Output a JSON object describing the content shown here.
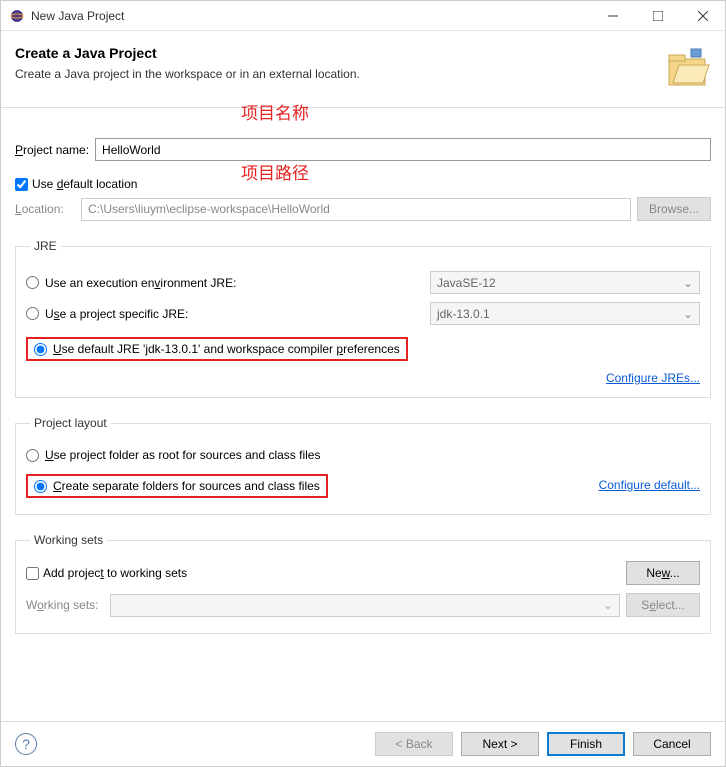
{
  "window": {
    "title": "New Java Project"
  },
  "header": {
    "title": "Create a Java Project",
    "desc": "Create a Java project in the workspace or in an external location."
  },
  "annotations": {
    "name": "项目名称",
    "path": "项目路径"
  },
  "project": {
    "name_label": "Project name:",
    "name_value": "HelloWorld",
    "default_loc_label": "Use default location",
    "location_label": "Location:",
    "location_value": "C:\\Users\\liuym\\eclipse-workspace\\HelloWorld",
    "browse_label": "Browse..."
  },
  "jre": {
    "legend": "JRE",
    "exec_env_label": "Use an execution environment JRE:",
    "exec_env_value": "JavaSE-12",
    "proj_specific_label": "Use a project specific JRE:",
    "proj_specific_value": "jdk-13.0.1",
    "default_label": "Use default JRE 'jdk-13.0.1' and workspace compiler preferences",
    "configure_link": "Configure JREs..."
  },
  "layout": {
    "legend": "Project layout",
    "root_label": "Use project folder as root for sources and class files",
    "separate_label": "Create separate folders for sources and class files",
    "configure_link": "Configure default..."
  },
  "workingsets": {
    "legend": "Working sets",
    "add_label": "Add project to working sets",
    "new_btn": "New...",
    "ws_label": "Working sets:",
    "select_btn": "Select..."
  },
  "footer": {
    "back": "< Back",
    "next": "Next >",
    "finish": "Finish",
    "cancel": "Cancel"
  }
}
